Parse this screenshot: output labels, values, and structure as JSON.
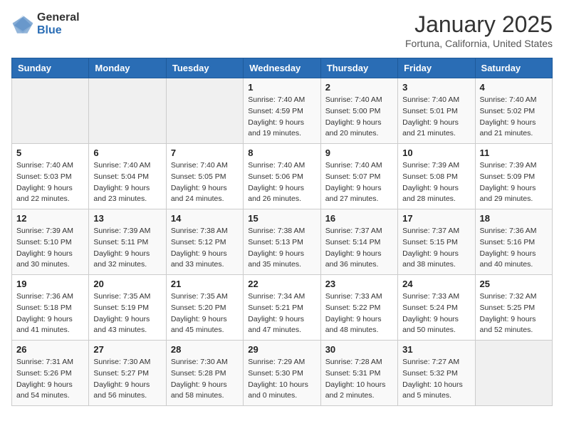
{
  "header": {
    "logo_general": "General",
    "logo_blue": "Blue",
    "month_title": "January 2025",
    "location": "Fortuna, California, United States"
  },
  "weekdays": [
    "Sunday",
    "Monday",
    "Tuesday",
    "Wednesday",
    "Thursday",
    "Friday",
    "Saturday"
  ],
  "weeks": [
    [
      {
        "day": "",
        "sunrise": "",
        "sunset": "",
        "daylight": ""
      },
      {
        "day": "",
        "sunrise": "",
        "sunset": "",
        "daylight": ""
      },
      {
        "day": "",
        "sunrise": "",
        "sunset": "",
        "daylight": ""
      },
      {
        "day": "1",
        "sunrise": "Sunrise: 7:40 AM",
        "sunset": "Sunset: 4:59 PM",
        "daylight": "Daylight: 9 hours and 19 minutes."
      },
      {
        "day": "2",
        "sunrise": "Sunrise: 7:40 AM",
        "sunset": "Sunset: 5:00 PM",
        "daylight": "Daylight: 9 hours and 20 minutes."
      },
      {
        "day": "3",
        "sunrise": "Sunrise: 7:40 AM",
        "sunset": "Sunset: 5:01 PM",
        "daylight": "Daylight: 9 hours and 21 minutes."
      },
      {
        "day": "4",
        "sunrise": "Sunrise: 7:40 AM",
        "sunset": "Sunset: 5:02 PM",
        "daylight": "Daylight: 9 hours and 21 minutes."
      }
    ],
    [
      {
        "day": "5",
        "sunrise": "Sunrise: 7:40 AM",
        "sunset": "Sunset: 5:03 PM",
        "daylight": "Daylight: 9 hours and 22 minutes."
      },
      {
        "day": "6",
        "sunrise": "Sunrise: 7:40 AM",
        "sunset": "Sunset: 5:04 PM",
        "daylight": "Daylight: 9 hours and 23 minutes."
      },
      {
        "day": "7",
        "sunrise": "Sunrise: 7:40 AM",
        "sunset": "Sunset: 5:05 PM",
        "daylight": "Daylight: 9 hours and 24 minutes."
      },
      {
        "day": "8",
        "sunrise": "Sunrise: 7:40 AM",
        "sunset": "Sunset: 5:06 PM",
        "daylight": "Daylight: 9 hours and 26 minutes."
      },
      {
        "day": "9",
        "sunrise": "Sunrise: 7:40 AM",
        "sunset": "Sunset: 5:07 PM",
        "daylight": "Daylight: 9 hours and 27 minutes."
      },
      {
        "day": "10",
        "sunrise": "Sunrise: 7:39 AM",
        "sunset": "Sunset: 5:08 PM",
        "daylight": "Daylight: 9 hours and 28 minutes."
      },
      {
        "day": "11",
        "sunrise": "Sunrise: 7:39 AM",
        "sunset": "Sunset: 5:09 PM",
        "daylight": "Daylight: 9 hours and 29 minutes."
      }
    ],
    [
      {
        "day": "12",
        "sunrise": "Sunrise: 7:39 AM",
        "sunset": "Sunset: 5:10 PM",
        "daylight": "Daylight: 9 hours and 30 minutes."
      },
      {
        "day": "13",
        "sunrise": "Sunrise: 7:39 AM",
        "sunset": "Sunset: 5:11 PM",
        "daylight": "Daylight: 9 hours and 32 minutes."
      },
      {
        "day": "14",
        "sunrise": "Sunrise: 7:38 AM",
        "sunset": "Sunset: 5:12 PM",
        "daylight": "Daylight: 9 hours and 33 minutes."
      },
      {
        "day": "15",
        "sunrise": "Sunrise: 7:38 AM",
        "sunset": "Sunset: 5:13 PM",
        "daylight": "Daylight: 9 hours and 35 minutes."
      },
      {
        "day": "16",
        "sunrise": "Sunrise: 7:37 AM",
        "sunset": "Sunset: 5:14 PM",
        "daylight": "Daylight: 9 hours and 36 minutes."
      },
      {
        "day": "17",
        "sunrise": "Sunrise: 7:37 AM",
        "sunset": "Sunset: 5:15 PM",
        "daylight": "Daylight: 9 hours and 38 minutes."
      },
      {
        "day": "18",
        "sunrise": "Sunrise: 7:36 AM",
        "sunset": "Sunset: 5:16 PM",
        "daylight": "Daylight: 9 hours and 40 minutes."
      }
    ],
    [
      {
        "day": "19",
        "sunrise": "Sunrise: 7:36 AM",
        "sunset": "Sunset: 5:18 PM",
        "daylight": "Daylight: 9 hours and 41 minutes."
      },
      {
        "day": "20",
        "sunrise": "Sunrise: 7:35 AM",
        "sunset": "Sunset: 5:19 PM",
        "daylight": "Daylight: 9 hours and 43 minutes."
      },
      {
        "day": "21",
        "sunrise": "Sunrise: 7:35 AM",
        "sunset": "Sunset: 5:20 PM",
        "daylight": "Daylight: 9 hours and 45 minutes."
      },
      {
        "day": "22",
        "sunrise": "Sunrise: 7:34 AM",
        "sunset": "Sunset: 5:21 PM",
        "daylight": "Daylight: 9 hours and 47 minutes."
      },
      {
        "day": "23",
        "sunrise": "Sunrise: 7:33 AM",
        "sunset": "Sunset: 5:22 PM",
        "daylight": "Daylight: 9 hours and 48 minutes."
      },
      {
        "day": "24",
        "sunrise": "Sunrise: 7:33 AM",
        "sunset": "Sunset: 5:24 PM",
        "daylight": "Daylight: 9 hours and 50 minutes."
      },
      {
        "day": "25",
        "sunrise": "Sunrise: 7:32 AM",
        "sunset": "Sunset: 5:25 PM",
        "daylight": "Daylight: 9 hours and 52 minutes."
      }
    ],
    [
      {
        "day": "26",
        "sunrise": "Sunrise: 7:31 AM",
        "sunset": "Sunset: 5:26 PM",
        "daylight": "Daylight: 9 hours and 54 minutes."
      },
      {
        "day": "27",
        "sunrise": "Sunrise: 7:30 AM",
        "sunset": "Sunset: 5:27 PM",
        "daylight": "Daylight: 9 hours and 56 minutes."
      },
      {
        "day": "28",
        "sunrise": "Sunrise: 7:30 AM",
        "sunset": "Sunset: 5:28 PM",
        "daylight": "Daylight: 9 hours and 58 minutes."
      },
      {
        "day": "29",
        "sunrise": "Sunrise: 7:29 AM",
        "sunset": "Sunset: 5:30 PM",
        "daylight": "Daylight: 10 hours and 0 minutes."
      },
      {
        "day": "30",
        "sunrise": "Sunrise: 7:28 AM",
        "sunset": "Sunset: 5:31 PM",
        "daylight": "Daylight: 10 hours and 2 minutes."
      },
      {
        "day": "31",
        "sunrise": "Sunrise: 7:27 AM",
        "sunset": "Sunset: 5:32 PM",
        "daylight": "Daylight: 10 hours and 5 minutes."
      },
      {
        "day": "",
        "sunrise": "",
        "sunset": "",
        "daylight": ""
      }
    ]
  ]
}
